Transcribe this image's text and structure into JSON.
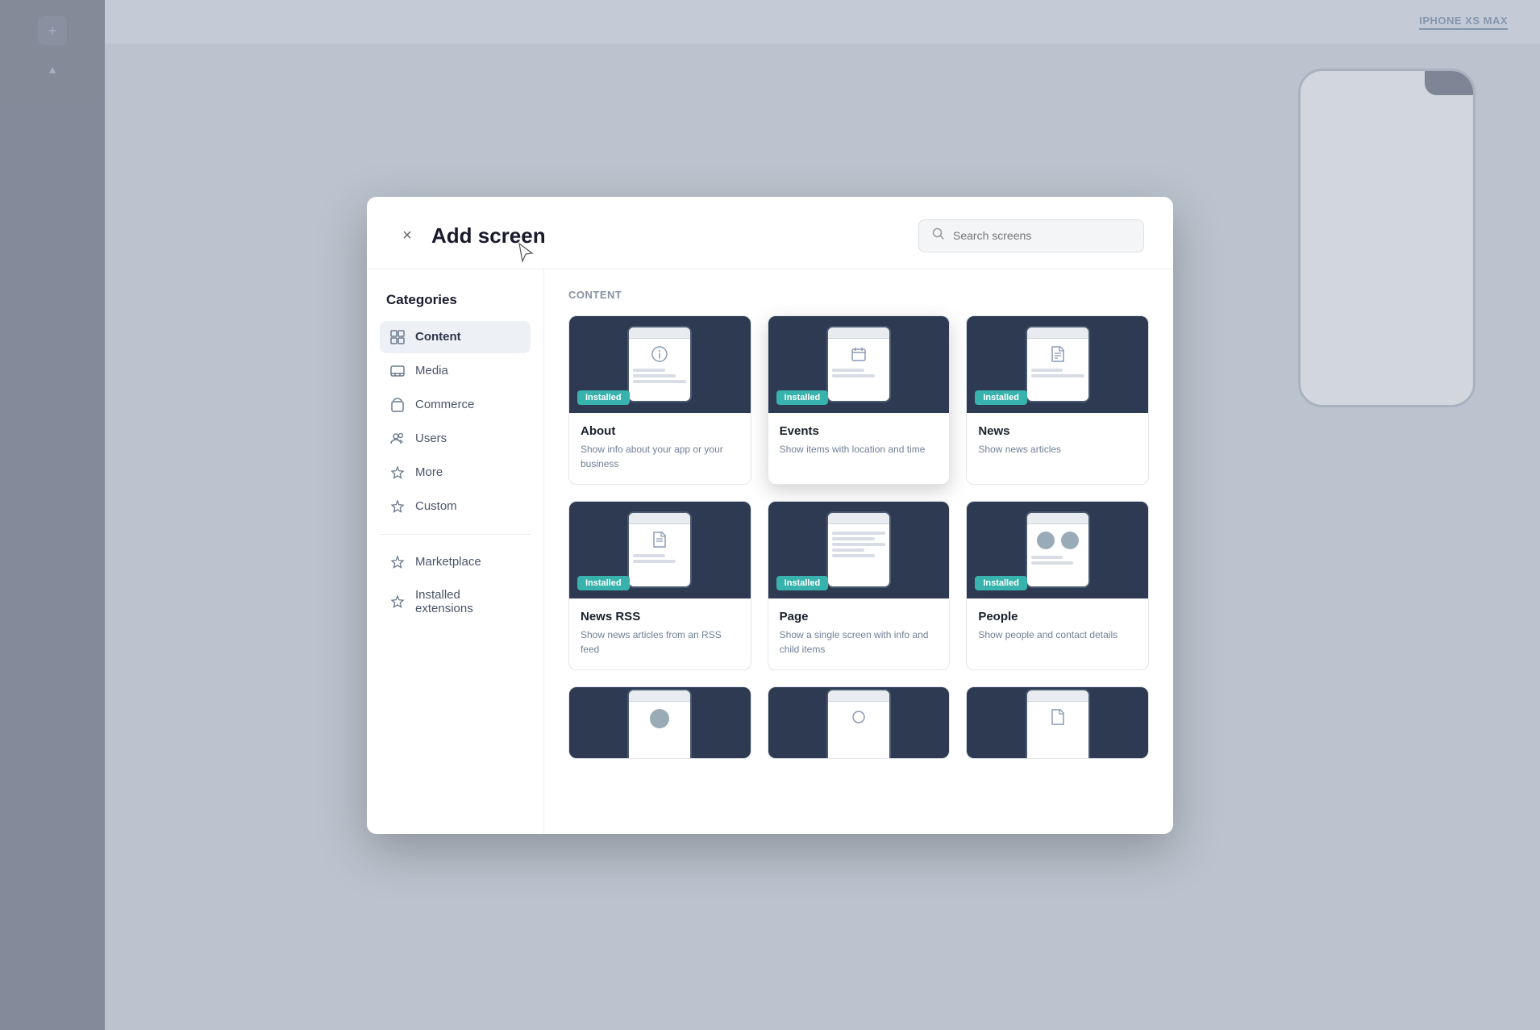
{
  "app": {
    "device_label": "IPHONE XS MAX"
  },
  "modal": {
    "title": "Add screen",
    "close_label": "×",
    "search_placeholder": "Search screens",
    "categories_title": "Categories",
    "content_section": "Content"
  },
  "sidebar": {
    "items": [
      {
        "id": "content",
        "label": "Content",
        "icon": "▦",
        "active": true
      },
      {
        "id": "media",
        "label": "Media",
        "icon": "📺",
        "active": false
      },
      {
        "id": "commerce",
        "label": "Commerce",
        "icon": "🛍",
        "active": false
      },
      {
        "id": "users",
        "label": "Users",
        "icon": "👤",
        "active": false
      },
      {
        "id": "more",
        "label": "More",
        "icon": "✦",
        "active": false
      },
      {
        "id": "custom",
        "label": "Custom",
        "icon": "✦",
        "active": false
      },
      {
        "id": "marketplace",
        "label": "Marketplace",
        "icon": "✦",
        "active": false
      },
      {
        "id": "installed",
        "label": "Installed extensions",
        "icon": "✦",
        "active": false
      }
    ]
  },
  "cards": [
    {
      "id": "about",
      "name": "About",
      "description": "Show info about your app or your business",
      "installed": true,
      "preview_type": "info"
    },
    {
      "id": "events",
      "name": "Events",
      "description": "Show items with location and time",
      "installed": true,
      "preview_type": "calendar"
    },
    {
      "id": "news",
      "name": "News",
      "description": "Show news articles",
      "installed": true,
      "preview_type": "document"
    },
    {
      "id": "news-rss",
      "name": "News RSS",
      "description": "Show news articles from an RSS feed",
      "installed": true,
      "preview_type": "document"
    },
    {
      "id": "page",
      "name": "Page",
      "description": "Show a single screen with info and child items",
      "installed": true,
      "preview_type": "lines"
    },
    {
      "id": "people",
      "name": "People",
      "description": "Show people and contact details",
      "installed": true,
      "preview_type": "people"
    },
    {
      "id": "card7",
      "name": "",
      "description": "",
      "installed": false,
      "preview_type": "person"
    },
    {
      "id": "card8",
      "name": "",
      "description": "",
      "installed": false,
      "preview_type": "circle"
    },
    {
      "id": "card9",
      "name": "",
      "description": "",
      "installed": false,
      "preview_type": "document"
    }
  ],
  "badges": {
    "installed": "Installed"
  }
}
